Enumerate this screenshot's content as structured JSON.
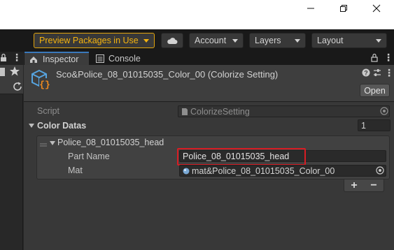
{
  "window": {
    "minimize": "—",
    "maximize": "❐",
    "close": "✕"
  },
  "toolbar": {
    "preview_packages": "Preview Packages in Use",
    "account": "Account",
    "layers": "Layers",
    "layout": "Layout",
    "cloud_icon": "cloud-icon"
  },
  "tabs": {
    "inspector": "Inspector",
    "console": "Console"
  },
  "inspector": {
    "title": "Sco&Police_08_01015035_Color_00 (Colorize Setting)",
    "open_label": "Open",
    "script_label": "Script",
    "script_value": "ColorizeSetting",
    "color_datas_label": "Color Datas",
    "color_datas_count": "1",
    "element": {
      "header": "Police_08_01015035_head",
      "part_name_label": "Part Name",
      "part_name_value": "Police_08_01015035_head",
      "mat_label": "Mat",
      "mat_value": "mat&Police_08_01015035_Color_00"
    },
    "add_label": "+",
    "remove_label": "−"
  },
  "colors": {
    "accent": "#f4b30f",
    "tab_active": "#3a79bb",
    "highlight": "#d71d24"
  }
}
